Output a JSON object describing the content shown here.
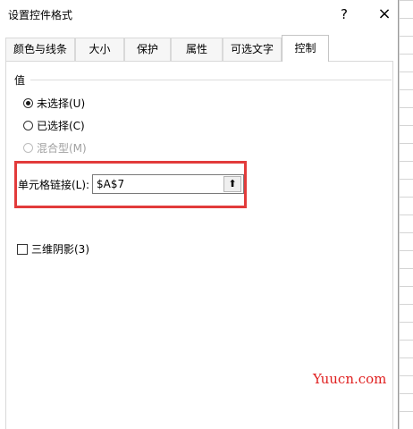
{
  "dialog": {
    "title": "设置控件格式",
    "help_glyph": "?",
    "close_glyph": "×"
  },
  "tabs": [
    {
      "label": "颜色与线条",
      "active": false
    },
    {
      "label": "大小",
      "active": false
    },
    {
      "label": "保护",
      "active": false
    },
    {
      "label": "属性",
      "active": false
    },
    {
      "label": "可选文字",
      "active": false
    },
    {
      "label": "控制",
      "active": true
    }
  ],
  "control": {
    "value_group_label": "值",
    "options": [
      {
        "label": "未选择(U)",
        "checked": true,
        "disabled": false
      },
      {
        "label": "已选择(C)",
        "checked": false,
        "disabled": false
      },
      {
        "label": "混合型(M)",
        "checked": false,
        "disabled": true
      }
    ],
    "cell_link_label": "单元格链接(L):",
    "cell_link_value": "$A$7",
    "collapse_glyph": "⬆",
    "shading_label": "三维阴影(3)",
    "shading_checked": false
  },
  "watermark": "Yuucn.com",
  "colors": {
    "highlight": "#e23b3b",
    "watermark": "#e02020"
  }
}
